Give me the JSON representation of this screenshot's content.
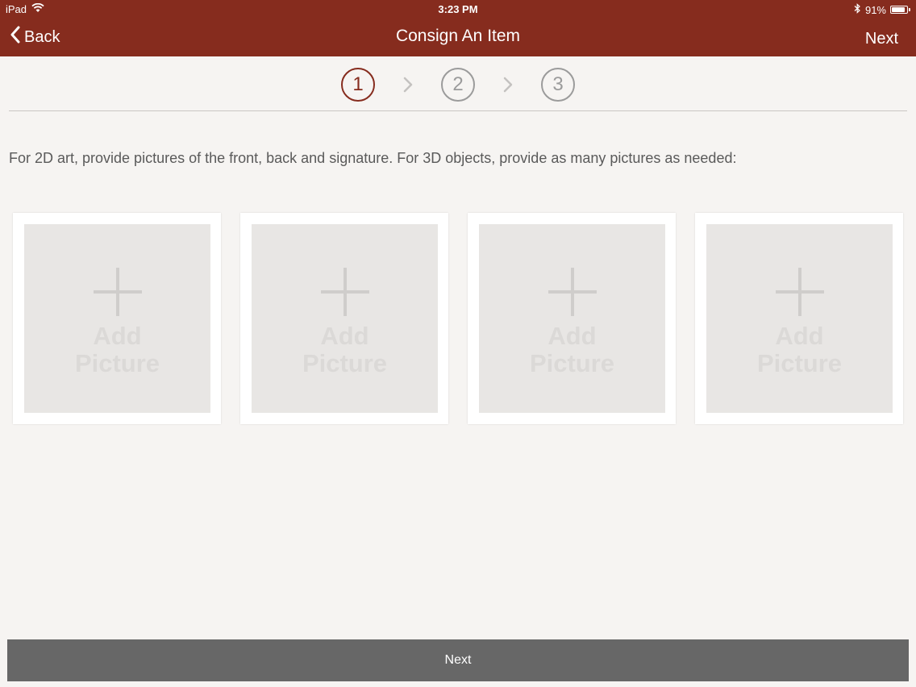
{
  "status_bar": {
    "device": "iPad",
    "time": "3:23 PM",
    "battery": "91%",
    "battery_level": 0.91
  },
  "nav": {
    "back_label": "Back",
    "title": "Consign An Item",
    "next_label": "Next"
  },
  "steps": [
    {
      "label": "1",
      "active": true
    },
    {
      "label": "2",
      "active": false
    },
    {
      "label": "3",
      "active": false
    }
  ],
  "instructions": "For 2D art, provide pictures of the front, back and signature.  For 3D objects, provide as many pictures as needed:",
  "picture_slots": [
    {
      "line1": "Add",
      "line2": "Picture"
    },
    {
      "line1": "Add",
      "line2": "Picture"
    },
    {
      "line1": "Add",
      "line2": "Picture"
    },
    {
      "line1": "Add",
      "line2": "Picture"
    }
  ],
  "bottom_button": {
    "label": "Next"
  },
  "colors": {
    "header": "#862c1e",
    "active_step": "#862c1e",
    "inactive_step": "#9b9b9b",
    "bottom_button": "#676767",
    "background": "#f6f4f2"
  },
  "icons": {
    "wifi": "wifi-icon",
    "bluetooth": "bluetooth-icon",
    "battery": "battery-icon",
    "back": "chevron-left-icon",
    "step_separator": "chevron-right-icon",
    "add": "plus-icon"
  }
}
